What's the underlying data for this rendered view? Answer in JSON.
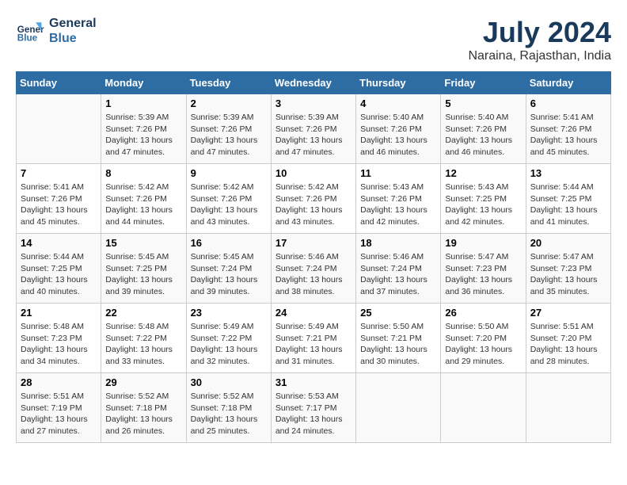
{
  "header": {
    "logo_line1": "General",
    "logo_line2": "Blue",
    "month": "July 2024",
    "location": "Naraina, Rajasthan, India"
  },
  "columns": [
    "Sunday",
    "Monday",
    "Tuesday",
    "Wednesday",
    "Thursday",
    "Friday",
    "Saturday"
  ],
  "weeks": [
    [
      {
        "day": "",
        "info": ""
      },
      {
        "day": "1",
        "info": "Sunrise: 5:39 AM\nSunset: 7:26 PM\nDaylight: 13 hours\nand 47 minutes."
      },
      {
        "day": "2",
        "info": "Sunrise: 5:39 AM\nSunset: 7:26 PM\nDaylight: 13 hours\nand 47 minutes."
      },
      {
        "day": "3",
        "info": "Sunrise: 5:39 AM\nSunset: 7:26 PM\nDaylight: 13 hours\nand 47 minutes."
      },
      {
        "day": "4",
        "info": "Sunrise: 5:40 AM\nSunset: 7:26 PM\nDaylight: 13 hours\nand 46 minutes."
      },
      {
        "day": "5",
        "info": "Sunrise: 5:40 AM\nSunset: 7:26 PM\nDaylight: 13 hours\nand 46 minutes."
      },
      {
        "day": "6",
        "info": "Sunrise: 5:41 AM\nSunset: 7:26 PM\nDaylight: 13 hours\nand 45 minutes."
      }
    ],
    [
      {
        "day": "7",
        "info": "Sunrise: 5:41 AM\nSunset: 7:26 PM\nDaylight: 13 hours\nand 45 minutes."
      },
      {
        "day": "8",
        "info": "Sunrise: 5:42 AM\nSunset: 7:26 PM\nDaylight: 13 hours\nand 44 minutes."
      },
      {
        "day": "9",
        "info": "Sunrise: 5:42 AM\nSunset: 7:26 PM\nDaylight: 13 hours\nand 43 minutes."
      },
      {
        "day": "10",
        "info": "Sunrise: 5:42 AM\nSunset: 7:26 PM\nDaylight: 13 hours\nand 43 minutes."
      },
      {
        "day": "11",
        "info": "Sunrise: 5:43 AM\nSunset: 7:26 PM\nDaylight: 13 hours\nand 42 minutes."
      },
      {
        "day": "12",
        "info": "Sunrise: 5:43 AM\nSunset: 7:25 PM\nDaylight: 13 hours\nand 42 minutes."
      },
      {
        "day": "13",
        "info": "Sunrise: 5:44 AM\nSunset: 7:25 PM\nDaylight: 13 hours\nand 41 minutes."
      }
    ],
    [
      {
        "day": "14",
        "info": "Sunrise: 5:44 AM\nSunset: 7:25 PM\nDaylight: 13 hours\nand 40 minutes."
      },
      {
        "day": "15",
        "info": "Sunrise: 5:45 AM\nSunset: 7:25 PM\nDaylight: 13 hours\nand 39 minutes."
      },
      {
        "day": "16",
        "info": "Sunrise: 5:45 AM\nSunset: 7:24 PM\nDaylight: 13 hours\nand 39 minutes."
      },
      {
        "day": "17",
        "info": "Sunrise: 5:46 AM\nSunset: 7:24 PM\nDaylight: 13 hours\nand 38 minutes."
      },
      {
        "day": "18",
        "info": "Sunrise: 5:46 AM\nSunset: 7:24 PM\nDaylight: 13 hours\nand 37 minutes."
      },
      {
        "day": "19",
        "info": "Sunrise: 5:47 AM\nSunset: 7:23 PM\nDaylight: 13 hours\nand 36 minutes."
      },
      {
        "day": "20",
        "info": "Sunrise: 5:47 AM\nSunset: 7:23 PM\nDaylight: 13 hours\nand 35 minutes."
      }
    ],
    [
      {
        "day": "21",
        "info": "Sunrise: 5:48 AM\nSunset: 7:23 PM\nDaylight: 13 hours\nand 34 minutes."
      },
      {
        "day": "22",
        "info": "Sunrise: 5:48 AM\nSunset: 7:22 PM\nDaylight: 13 hours\nand 33 minutes."
      },
      {
        "day": "23",
        "info": "Sunrise: 5:49 AM\nSunset: 7:22 PM\nDaylight: 13 hours\nand 32 minutes."
      },
      {
        "day": "24",
        "info": "Sunrise: 5:49 AM\nSunset: 7:21 PM\nDaylight: 13 hours\nand 31 minutes."
      },
      {
        "day": "25",
        "info": "Sunrise: 5:50 AM\nSunset: 7:21 PM\nDaylight: 13 hours\nand 30 minutes."
      },
      {
        "day": "26",
        "info": "Sunrise: 5:50 AM\nSunset: 7:20 PM\nDaylight: 13 hours\nand 29 minutes."
      },
      {
        "day": "27",
        "info": "Sunrise: 5:51 AM\nSunset: 7:20 PM\nDaylight: 13 hours\nand 28 minutes."
      }
    ],
    [
      {
        "day": "28",
        "info": "Sunrise: 5:51 AM\nSunset: 7:19 PM\nDaylight: 13 hours\nand 27 minutes."
      },
      {
        "day": "29",
        "info": "Sunrise: 5:52 AM\nSunset: 7:18 PM\nDaylight: 13 hours\nand 26 minutes."
      },
      {
        "day": "30",
        "info": "Sunrise: 5:52 AM\nSunset: 7:18 PM\nDaylight: 13 hours\nand 25 minutes."
      },
      {
        "day": "31",
        "info": "Sunrise: 5:53 AM\nSunset: 7:17 PM\nDaylight: 13 hours\nand 24 minutes."
      },
      {
        "day": "",
        "info": ""
      },
      {
        "day": "",
        "info": ""
      },
      {
        "day": "",
        "info": ""
      }
    ]
  ]
}
